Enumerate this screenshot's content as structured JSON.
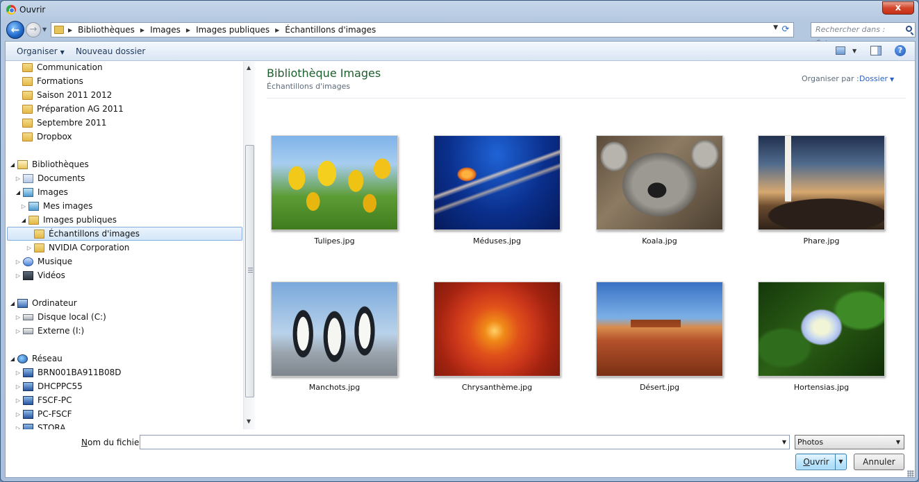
{
  "window": {
    "title": "Ouvrir",
    "close_glyph": "x"
  },
  "navigation": {
    "breadcrumbs": [
      "Bibliothèques",
      "Images",
      "Images publiques",
      "Échantillons d'images"
    ],
    "search_placeholder": "Rechercher dans : Échan..."
  },
  "toolbar": {
    "organize_label": "Organiser",
    "new_folder_label": "Nouveau dossier"
  },
  "tree": {
    "communication": "Communication",
    "formations": "Formations",
    "saison": "Saison 2011 2012",
    "preparation": "Préparation AG 2011",
    "septembre": "Septembre 2011",
    "dropbox": "Dropbox",
    "bibliotheques": "Bibliothèques",
    "documents": "Documents",
    "images": "Images",
    "mes_images": "Mes images",
    "images_publiques": "Images publiques",
    "echantillons": "Échantillons d'images",
    "nvidia": "NVIDIA Corporation",
    "musique": "Musique",
    "videos": "Vidéos",
    "ordinateur": "Ordinateur",
    "disque_local": "Disque local (C:)",
    "externe": "Externe (I:)",
    "reseau": "Réseau",
    "brn": "BRN001BA911B08D",
    "dhcppc": "DHCPPC55",
    "fscf_pc": "FSCF-PC",
    "pc_fscf": "PC-FSCF",
    "stora": "STORA"
  },
  "library": {
    "title": "Bibliothèque Images",
    "subtitle": "Échantillons d'images",
    "arrange_label": "Organiser par :",
    "arrange_value": "Dossier"
  },
  "files": {
    "f0": "Tulipes.jpg",
    "f1": "Méduses.jpg",
    "f2": "Koala.jpg",
    "f3": "Phare.jpg",
    "f4": "Manchots.jpg",
    "f5": "Chrysanthème.jpg",
    "f6": "Désert.jpg",
    "f7": "Hortensias.jpg"
  },
  "footer": {
    "filename_label_prefix": "N",
    "filename_label_rest": "om du fichier :",
    "filename_value": "",
    "filetype_value": "Photos",
    "open_label_prefix": "O",
    "open_label_rest": "uvrir",
    "cancel_label": "Annuler"
  }
}
